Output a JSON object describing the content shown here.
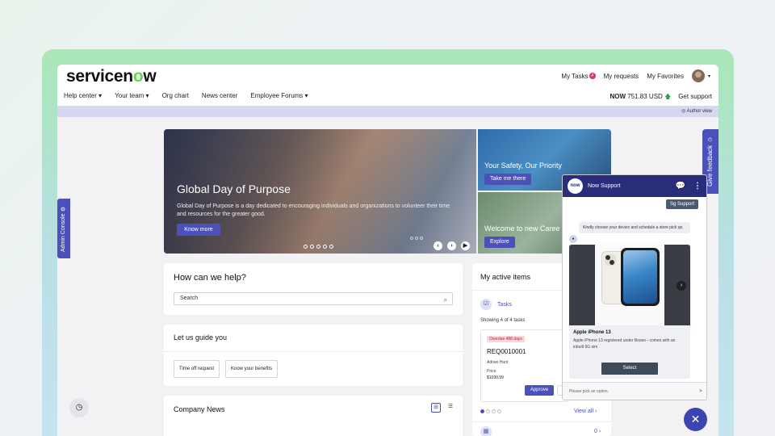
{
  "header": {
    "logo_text": "servicen",
    "logo_o": "o",
    "logo_end": "w",
    "links": {
      "tasks": "My Tasks",
      "tasks_count": "4",
      "requests": "My requests",
      "favorites": "My Favorites"
    },
    "nav": [
      "Help center ▾",
      "Your team ▾",
      "Org chart",
      "News center",
      "Employee Forums ▾"
    ],
    "stock_symbol": "NOW",
    "stock_value": "751.83 USD",
    "stock_arrow": "🡅",
    "support": "Get support",
    "author_view": "◎ Author view"
  },
  "side_tabs": {
    "admin": "Admin Console ⚙",
    "feedback": "Give feedback ☺"
  },
  "hero": {
    "title": "Global Day of Purpose",
    "description": "Global Day of Purpose is a day dedicated to encouraging individuals and organizations to volunteer their time and resources for the greater good.",
    "button": "Know more",
    "side1_title": "Your Safety, Our Priority",
    "side1_button": "Take me there",
    "side2_title": "Welcome to new Caree",
    "side2_button": "Explore",
    "prev": "‹",
    "next": "›",
    "play": "▶"
  },
  "help": {
    "title": "How can we help?",
    "search_placeholder": "Search",
    "search_icon": "⌕"
  },
  "guide": {
    "title": "Let us guide you",
    "buttons": [
      "Time off request",
      "Know your benefits"
    ]
  },
  "news": {
    "title": "Company News",
    "grid_icon": "⊞",
    "list_icon": "☰"
  },
  "active_items": {
    "title": "My active items",
    "tasks_label": "Tasks",
    "showing": "Showing 4 of 4 tasks",
    "task": {
      "badge": "Overdue 488 days",
      "number": "REQ0010001",
      "person": "Adrian Hunt",
      "price_label": "Price",
      "price": "$1099.99",
      "approve": "Approve"
    },
    "view_all": "View all ›",
    "count": "0 ›"
  },
  "chat": {
    "title": "Now Support",
    "logo": "now",
    "sg_support": "Sg Support",
    "bot_msg": "Kindly choose your device and schedule a store pick up.",
    "product_name": "Apple iPhone 13",
    "product_desc": "Apple iPhone 13 registered under Boseo - comes with an inbuilt 5G sim",
    "select": "Select",
    "input_placeholder": "Please pick an option.",
    "send_icon": "➤",
    "close_icon": "✕"
  }
}
